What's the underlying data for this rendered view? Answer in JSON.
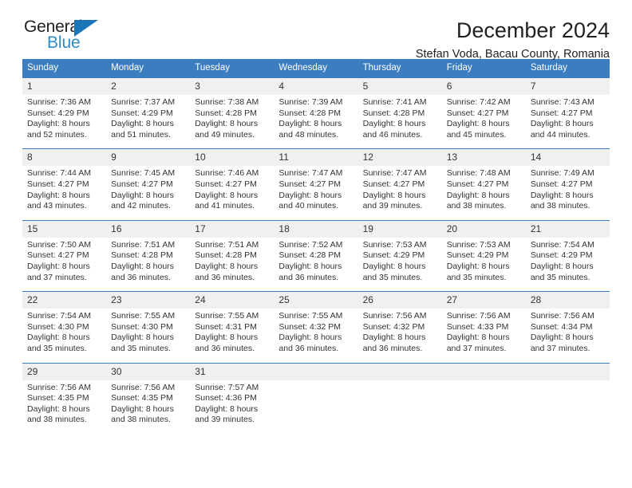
{
  "logo": {
    "word_one": "General",
    "word_two": "Blue",
    "triangle": "blue-triangle-icon",
    "colors": {
      "dark": "#231f20",
      "blue": "#2e8bc9",
      "triangle": "#1b75bb"
    }
  },
  "header": {
    "title": "December 2024",
    "subtitle": "Stefan Voda, Bacau County, Romania"
  },
  "theme": {
    "header_bg": "#3b7dbf",
    "header_text": "#ffffff",
    "daynum_bg": "#f0f0f0",
    "body_text": "#333333",
    "separator": "#3b7dbf"
  },
  "calendar": {
    "weekday_headers": [
      "Sunday",
      "Monday",
      "Tuesday",
      "Wednesday",
      "Thursday",
      "Friday",
      "Saturday"
    ],
    "labels": {
      "sunrise": "Sunrise:",
      "sunset": "Sunset:",
      "daylight": "Daylight:"
    },
    "weeks": [
      {
        "days": [
          {
            "date": "1",
            "sunrise": "Sunrise: 7:36 AM",
            "sunset": "Sunset: 4:29 PM",
            "daylight_1": "Daylight: 8 hours",
            "daylight_2": "and 52 minutes."
          },
          {
            "date": "2",
            "sunrise": "Sunrise: 7:37 AM",
            "sunset": "Sunset: 4:29 PM",
            "daylight_1": "Daylight: 8 hours",
            "daylight_2": "and 51 minutes."
          },
          {
            "date": "3",
            "sunrise": "Sunrise: 7:38 AM",
            "sunset": "Sunset: 4:28 PM",
            "daylight_1": "Daylight: 8 hours",
            "daylight_2": "and 49 minutes."
          },
          {
            "date": "4",
            "sunrise": "Sunrise: 7:39 AM",
            "sunset": "Sunset: 4:28 PM",
            "daylight_1": "Daylight: 8 hours",
            "daylight_2": "and 48 minutes."
          },
          {
            "date": "5",
            "sunrise": "Sunrise: 7:41 AM",
            "sunset": "Sunset: 4:28 PM",
            "daylight_1": "Daylight: 8 hours",
            "daylight_2": "and 46 minutes."
          },
          {
            "date": "6",
            "sunrise": "Sunrise: 7:42 AM",
            "sunset": "Sunset: 4:27 PM",
            "daylight_1": "Daylight: 8 hours",
            "daylight_2": "and 45 minutes."
          },
          {
            "date": "7",
            "sunrise": "Sunrise: 7:43 AM",
            "sunset": "Sunset: 4:27 PM",
            "daylight_1": "Daylight: 8 hours",
            "daylight_2": "and 44 minutes."
          }
        ]
      },
      {
        "days": [
          {
            "date": "8",
            "sunrise": "Sunrise: 7:44 AM",
            "sunset": "Sunset: 4:27 PM",
            "daylight_1": "Daylight: 8 hours",
            "daylight_2": "and 43 minutes."
          },
          {
            "date": "9",
            "sunrise": "Sunrise: 7:45 AM",
            "sunset": "Sunset: 4:27 PM",
            "daylight_1": "Daylight: 8 hours",
            "daylight_2": "and 42 minutes."
          },
          {
            "date": "10",
            "sunrise": "Sunrise: 7:46 AM",
            "sunset": "Sunset: 4:27 PM",
            "daylight_1": "Daylight: 8 hours",
            "daylight_2": "and 41 minutes."
          },
          {
            "date": "11",
            "sunrise": "Sunrise: 7:47 AM",
            "sunset": "Sunset: 4:27 PM",
            "daylight_1": "Daylight: 8 hours",
            "daylight_2": "and 40 minutes."
          },
          {
            "date": "12",
            "sunrise": "Sunrise: 7:47 AM",
            "sunset": "Sunset: 4:27 PM",
            "daylight_1": "Daylight: 8 hours",
            "daylight_2": "and 39 minutes."
          },
          {
            "date": "13",
            "sunrise": "Sunrise: 7:48 AM",
            "sunset": "Sunset: 4:27 PM",
            "daylight_1": "Daylight: 8 hours",
            "daylight_2": "and 38 minutes."
          },
          {
            "date": "14",
            "sunrise": "Sunrise: 7:49 AM",
            "sunset": "Sunset: 4:27 PM",
            "daylight_1": "Daylight: 8 hours",
            "daylight_2": "and 38 minutes."
          }
        ]
      },
      {
        "days": [
          {
            "date": "15",
            "sunrise": "Sunrise: 7:50 AM",
            "sunset": "Sunset: 4:27 PM",
            "daylight_1": "Daylight: 8 hours",
            "daylight_2": "and 37 minutes."
          },
          {
            "date": "16",
            "sunrise": "Sunrise: 7:51 AM",
            "sunset": "Sunset: 4:28 PM",
            "daylight_1": "Daylight: 8 hours",
            "daylight_2": "and 36 minutes."
          },
          {
            "date": "17",
            "sunrise": "Sunrise: 7:51 AM",
            "sunset": "Sunset: 4:28 PM",
            "daylight_1": "Daylight: 8 hours",
            "daylight_2": "and 36 minutes."
          },
          {
            "date": "18",
            "sunrise": "Sunrise: 7:52 AM",
            "sunset": "Sunset: 4:28 PM",
            "daylight_1": "Daylight: 8 hours",
            "daylight_2": "and 36 minutes."
          },
          {
            "date": "19",
            "sunrise": "Sunrise: 7:53 AM",
            "sunset": "Sunset: 4:29 PM",
            "daylight_1": "Daylight: 8 hours",
            "daylight_2": "and 35 minutes."
          },
          {
            "date": "20",
            "sunrise": "Sunrise: 7:53 AM",
            "sunset": "Sunset: 4:29 PM",
            "daylight_1": "Daylight: 8 hours",
            "daylight_2": "and 35 minutes."
          },
          {
            "date": "21",
            "sunrise": "Sunrise: 7:54 AM",
            "sunset": "Sunset: 4:29 PM",
            "daylight_1": "Daylight: 8 hours",
            "daylight_2": "and 35 minutes."
          }
        ]
      },
      {
        "days": [
          {
            "date": "22",
            "sunrise": "Sunrise: 7:54 AM",
            "sunset": "Sunset: 4:30 PM",
            "daylight_1": "Daylight: 8 hours",
            "daylight_2": "and 35 minutes."
          },
          {
            "date": "23",
            "sunrise": "Sunrise: 7:55 AM",
            "sunset": "Sunset: 4:30 PM",
            "daylight_1": "Daylight: 8 hours",
            "daylight_2": "and 35 minutes."
          },
          {
            "date": "24",
            "sunrise": "Sunrise: 7:55 AM",
            "sunset": "Sunset: 4:31 PM",
            "daylight_1": "Daylight: 8 hours",
            "daylight_2": "and 36 minutes."
          },
          {
            "date": "25",
            "sunrise": "Sunrise: 7:55 AM",
            "sunset": "Sunset: 4:32 PM",
            "daylight_1": "Daylight: 8 hours",
            "daylight_2": "and 36 minutes."
          },
          {
            "date": "26",
            "sunrise": "Sunrise: 7:56 AM",
            "sunset": "Sunset: 4:32 PM",
            "daylight_1": "Daylight: 8 hours",
            "daylight_2": "and 36 minutes."
          },
          {
            "date": "27",
            "sunrise": "Sunrise: 7:56 AM",
            "sunset": "Sunset: 4:33 PM",
            "daylight_1": "Daylight: 8 hours",
            "daylight_2": "and 37 minutes."
          },
          {
            "date": "28",
            "sunrise": "Sunrise: 7:56 AM",
            "sunset": "Sunset: 4:34 PM",
            "daylight_1": "Daylight: 8 hours",
            "daylight_2": "and 37 minutes."
          }
        ]
      },
      {
        "days": [
          {
            "date": "29",
            "sunrise": "Sunrise: 7:56 AM",
            "sunset": "Sunset: 4:35 PM",
            "daylight_1": "Daylight: 8 hours",
            "daylight_2": "and 38 minutes."
          },
          {
            "date": "30",
            "sunrise": "Sunrise: 7:56 AM",
            "sunset": "Sunset: 4:35 PM",
            "daylight_1": "Daylight: 8 hours",
            "daylight_2": "and 38 minutes."
          },
          {
            "date": "31",
            "sunrise": "Sunrise: 7:57 AM",
            "sunset": "Sunset: 4:36 PM",
            "daylight_1": "Daylight: 8 hours",
            "daylight_2": "and 39 minutes."
          },
          {
            "date": "",
            "sunrise": "",
            "sunset": "",
            "daylight_1": "",
            "daylight_2": ""
          },
          {
            "date": "",
            "sunrise": "",
            "sunset": "",
            "daylight_1": "",
            "daylight_2": ""
          },
          {
            "date": "",
            "sunrise": "",
            "sunset": "",
            "daylight_1": "",
            "daylight_2": ""
          },
          {
            "date": "",
            "sunrise": "",
            "sunset": "",
            "daylight_1": "",
            "daylight_2": ""
          }
        ]
      }
    ]
  }
}
